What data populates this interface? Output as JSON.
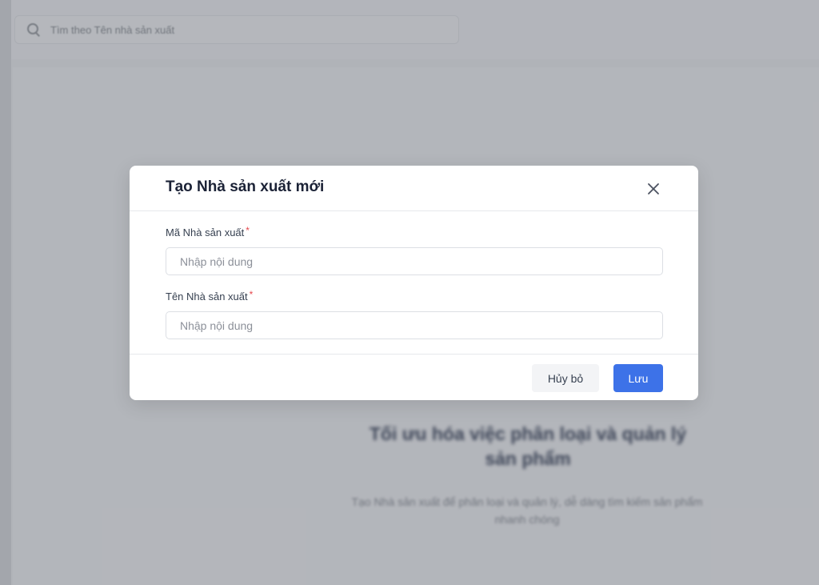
{
  "background": {
    "search_placeholder": "Tìm theo Tên nhà sản xuất",
    "empty_state": {
      "title": "Tối ưu hóa việc phân loại và quản lý sản phẩm",
      "description": "Tạo Nhà sản xuất để phân loại và quản lý, dễ dàng tìm kiếm sản phẩm nhanh chóng"
    }
  },
  "modal": {
    "title": "Tạo Nhà sản xuất mới",
    "close_icon": "close-icon",
    "fields": [
      {
        "label": "Mã Nhà sản xuất",
        "required_mark": "*",
        "value": "",
        "placeholder": "Nhập nội dung"
      },
      {
        "label": "Tên Nhà sản xuất",
        "required_mark": "*",
        "value": "",
        "placeholder": "Nhập nội dung"
      }
    ],
    "cancel_label": "Hủy bỏ",
    "save_label": "Lưu"
  },
  "colors": {
    "primary": "#3d72e8",
    "required": "#e5484d",
    "overlay": "rgba(100,104,112,0.45)"
  }
}
